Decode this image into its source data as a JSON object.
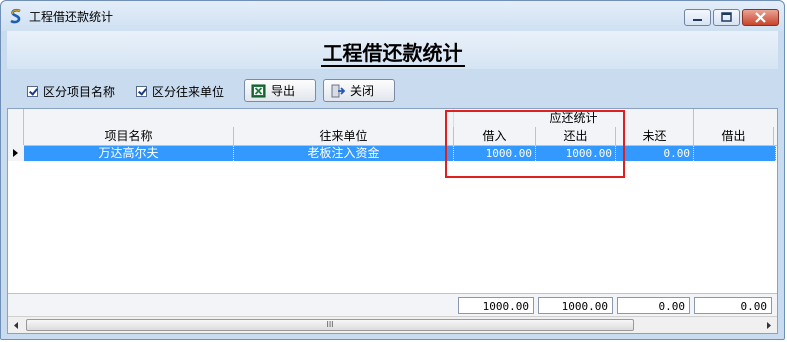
{
  "window": {
    "title": "工程借还款统计",
    "icon": "app-s-icon",
    "buttons": {
      "minimize": "minimize-icon",
      "maximize": "maximize-icon",
      "close": "close-icon"
    }
  },
  "report": {
    "title": "工程借还款统计"
  },
  "toolbar": {
    "checkbox_project": {
      "label": "区分项目名称",
      "checked": true
    },
    "checkbox_partner": {
      "label": "区分往来单位",
      "checked": true
    },
    "export_label": "导出",
    "close_label": "关闭"
  },
  "grid": {
    "group_header": "应还统计",
    "columns": [
      "项目名称",
      "往来单位",
      "借入",
      "还出",
      "未还",
      "借出"
    ],
    "rows": [
      {
        "project": "万达高尔夫",
        "partner": "老板注入资金",
        "borrow_in": "1000.00",
        "repay_out": "1000.00",
        "unpaid": "0.00",
        "lend_out": ""
      }
    ],
    "totals": {
      "borrow_in": "1000.00",
      "repay_out": "1000.00",
      "unpaid": "0.00",
      "lend_out": "0.00"
    },
    "selected_color": "#3399ff"
  },
  "scrollbar": {
    "thumb_glyph": "III"
  },
  "colors": {
    "highlight": "#e02020",
    "window_bg": "#c9dbef"
  }
}
